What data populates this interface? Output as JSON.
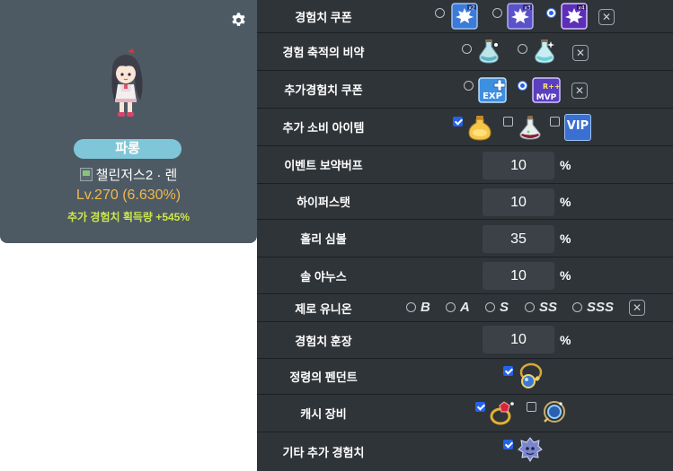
{
  "character": {
    "name": "파롱",
    "world": "챌린저스2 · 렌",
    "level": "Lv.270 (6.630%)",
    "exp_bonus": "추가 경험치 획득량 +545%"
  },
  "rows": {
    "exp_coupon": {
      "label": "경험치 쿠폰",
      "options": [
        "exp-coupon-2x-icon",
        "exp-coupon-3x-icon",
        "exp-coupon-4x-icon"
      ],
      "selected_index": 2,
      "clear": "✕"
    },
    "exp_potion": {
      "label": "경험 축적의 비약",
      "options": [
        "exp-potion-icon",
        "exp-potion-plus-icon"
      ],
      "selected_index": null,
      "clear": "✕"
    },
    "extra_coupon": {
      "label": "추가경험치 쿠폰",
      "options": [
        "exp-plus-coupon-icon",
        "mvp-plus-coupon-icon"
      ],
      "selected_index": 1,
      "clear": "✕"
    },
    "consumables": {
      "label": "추가 소비 아이템",
      "items": [
        {
          "icon": "gold-potion-icon",
          "checked": true
        },
        {
          "icon": "red-potion-icon",
          "checked": false
        },
        {
          "icon": "vip-icon",
          "checked": false,
          "text": "VIP"
        }
      ]
    },
    "event_buff": {
      "label": "이벤트 보약버프",
      "value": "10",
      "unit": "%"
    },
    "hyper_stat": {
      "label": "하이퍼스탯",
      "value": "10",
      "unit": "%"
    },
    "holy_symbol": {
      "label": "홀리 심볼",
      "value": "35",
      "unit": "%"
    },
    "sol_janus": {
      "label": "솔 야누스",
      "value": "10",
      "unit": "%"
    },
    "zero_union": {
      "label": "제로 유니온",
      "grades": [
        "B",
        "A",
        "S",
        "SS",
        "SSS"
      ],
      "selected_index": null,
      "clear": "✕"
    },
    "exp_medal": {
      "label": "경험치 훈장",
      "value": "10",
      "unit": "%"
    },
    "pendant": {
      "label": "정령의 펜던트",
      "checked": true,
      "icon": "spirit-pendant-icon"
    },
    "cash_equip": {
      "label": "캐시 장비",
      "items": [
        {
          "icon": "cash-ring-icon",
          "checked": true
        },
        {
          "icon": "cash-pendant-icon",
          "checked": false
        }
      ]
    },
    "other_exp": {
      "label": "기타 추가 경험치",
      "checked": true,
      "icon": "monster-badge-icon"
    }
  },
  "colors": {
    "card_bg": "#4e5a63",
    "panel_bg": "#2f3438",
    "name_pill": "#7ec6d8",
    "level": "#f0b84d",
    "bonus": "#cde84d",
    "accent": "#2563eb"
  }
}
